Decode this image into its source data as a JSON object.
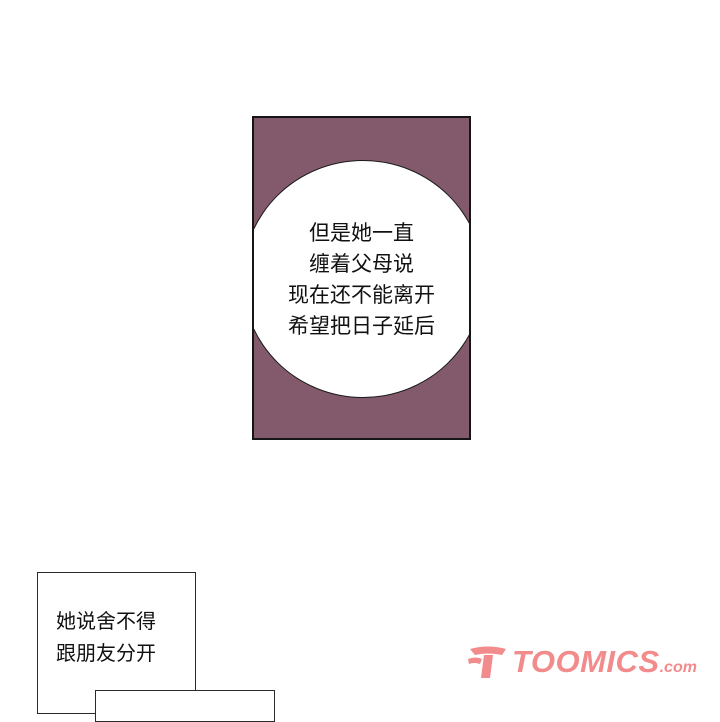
{
  "panel": {
    "lines": [
      "但是她一直",
      "缠着父母说",
      "现在还不能离开",
      "希望把日子延后"
    ],
    "colors": {
      "background": "#835a6c",
      "bubble": "#ffffff",
      "border": "#161616"
    }
  },
  "caption": {
    "lines": [
      "她说舍不得",
      "跟朋友分开"
    ]
  },
  "watermark": {
    "brand": "TOOMICS",
    "tld": ".com",
    "icon": "toomics-logo-icon",
    "color": "#f28b8b"
  }
}
